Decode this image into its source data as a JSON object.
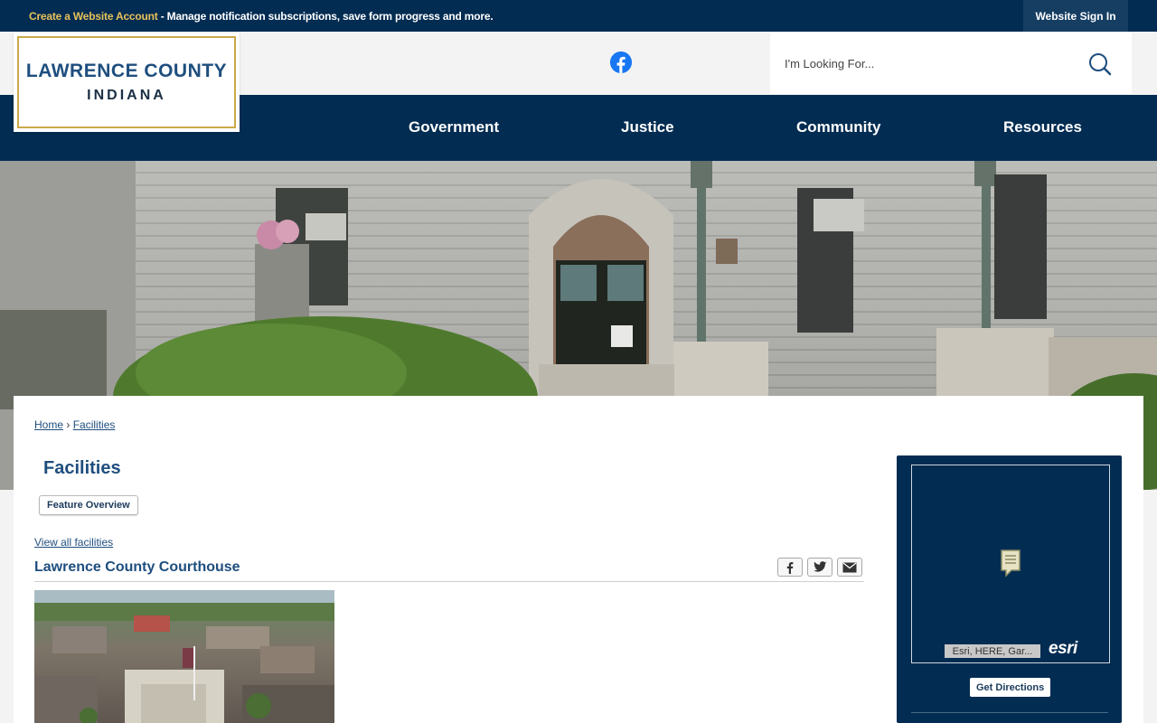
{
  "topbar": {
    "create_account": "Create a Website Account",
    "message": " - Manage notification subscriptions, save form progress and more.",
    "signin": "Website Sign In"
  },
  "logo": {
    "line1": "LAWRENCE COUNTY",
    "line2": "INDIANA"
  },
  "search": {
    "placeholder": "I'm Looking For..."
  },
  "nav": {
    "items": [
      "Government",
      "Justice",
      "Community",
      "Resources"
    ]
  },
  "breadcrumb": {
    "home": "Home",
    "separator": "›",
    "current": "Facilities"
  },
  "page": {
    "title": "Facilities",
    "feature_overview": "Feature Overview",
    "view_all": "View all facilities",
    "facility_name": "Lawrence County Courthouse"
  },
  "share": {
    "facebook": "f",
    "twitter": "t",
    "email": "✉"
  },
  "map": {
    "attribution": "Esri, HERE, Gar...",
    "logo": "esri",
    "directions": "Get Directions"
  },
  "icons": [
    "facebook-icon",
    "search-icon",
    "map-marker-icon",
    "facebook-share-icon",
    "twitter-share-icon",
    "email-share-icon"
  ],
  "colors": {
    "navy": "#022c52",
    "gold": "#e8c15a",
    "link": "#1e4e7e",
    "facebook": "#1877f2"
  }
}
